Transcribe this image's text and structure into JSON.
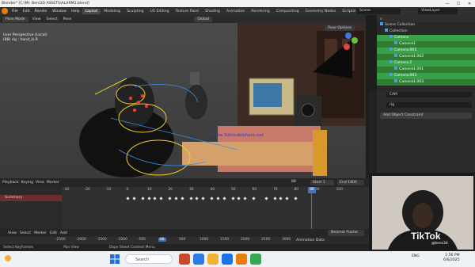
{
  "window": {
    "title": "Blender* [C:\\Mr. Ben\\3D ASSETS\\ALARM1.blend]",
    "minimize": "—",
    "maximize": "☐",
    "close": "✕"
  },
  "menu": {
    "items": [
      "File",
      "Edit",
      "Render",
      "Window",
      "Help"
    ],
    "workspaces": [
      "Layout",
      "Modeling",
      "Sculpting",
      "UV Editing",
      "Texture Paint",
      "Shading",
      "Animation",
      "Rendering",
      "Compositing",
      "Geometry Nodes",
      "Scripting"
    ],
    "active_workspace": "Layout",
    "scene": "Scene",
    "view_layer": "ViewLayer"
  },
  "viewport_header": {
    "mode": "Pose Mode",
    "menus": [
      "View",
      "Select",
      "Pose"
    ],
    "transform": "Global",
    "pose_options": "Pose Options"
  },
  "viewport": {
    "perspective": "User Perspective (Local)",
    "object": "(88) rig : hand_ik.R",
    "watermark": "www.3dmodelshare.net"
  },
  "outliner": {
    "search_placeholder": "",
    "items": [
      {
        "label": "Scene Collection",
        "level": 0,
        "state": "none"
      },
      {
        "label": "Collection",
        "level": 1,
        "state": "none"
      },
      {
        "label": "Camera",
        "level": 2,
        "state": "sel"
      },
      {
        "label": "Camera1",
        "level": 3,
        "state": "sel"
      },
      {
        "label": "Camera.001",
        "level": 2,
        "state": "sel"
      },
      {
        "label": "Camera1.002",
        "level": 3,
        "state": "sel"
      },
      {
        "label": "Camera.2",
        "level": 2,
        "state": "sel"
      },
      {
        "label": "Camera1.001",
        "level": 3,
        "state": "sel"
      },
      {
        "label": "Camera.003",
        "level": 2,
        "state": "sel"
      },
      {
        "label": "Camera1.003",
        "level": 3,
        "state": "sel"
      }
    ]
  },
  "properties": {
    "search": "CAM",
    "object": "rig",
    "add_constraint": "Add Object Constraint"
  },
  "timeline_controls": {
    "menus": [
      "Playback",
      "Keying",
      "View",
      "Marker"
    ],
    "current_frame": "88",
    "start_label": "Start",
    "start": "1",
    "end_label": "End",
    "end": "1800"
  },
  "dopesheet": {
    "summary": "Summary",
    "ticks": [
      "-30",
      "-20",
      "-10",
      "0",
      "10",
      "20",
      "30",
      "40",
      "50",
      "60",
      "70",
      "80",
      "90",
      "100"
    ],
    "current_frame": "88",
    "keyframes": [
      0,
      3,
      7,
      10,
      13,
      16,
      20,
      23,
      26,
      30,
      33,
      36,
      40,
      43,
      46,
      50,
      53,
      56,
      60,
      66,
      70,
      73,
      76,
      80
    ]
  },
  "lower_header": {
    "menus": [
      "View",
      "Select",
      "Marker",
      "Edit",
      "Add"
    ],
    "snap": "Nearest Frame"
  },
  "lower_ruler": {
    "ticks": [
      "-2500",
      "-2000",
      "-1500",
      "-1000",
      "-500",
      "88",
      "500",
      "1000",
      "1500",
      "2000",
      "2500",
      "3000"
    ],
    "animation_data": "Animation Data"
  },
  "status": {
    "items": [
      "Select Keyframes",
      "Pan View",
      "Dope Sheet Context Menu"
    ]
  },
  "overlay": {
    "brand": "TikTok",
    "handle": "@bens3d"
  },
  "taskbar": {
    "search": "Search",
    "clock_time": "1:56 PM",
    "clock_date": "6/6/2025",
    "tray": "ENG"
  }
}
